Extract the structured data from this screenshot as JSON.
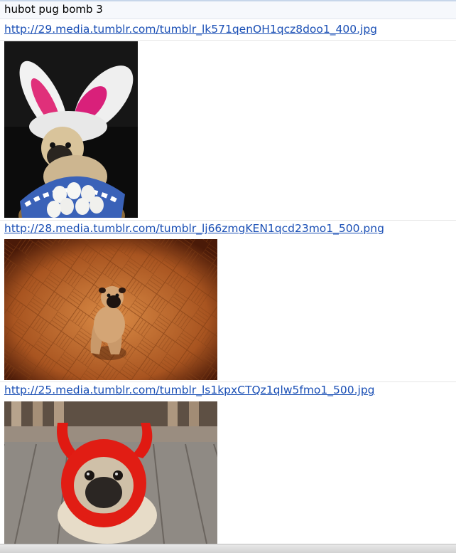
{
  "command": "hubot pug bomb 3",
  "messages": [
    {
      "url": "http://29.media.tumblr.com/tumblr_lk571qenOH1qcz8doo1_400.jpg",
      "image": "pug-bunny-ears-egg-basket"
    },
    {
      "url": "http://28.media.tumblr.com/tumblr_lj66zmgKEN1qcd23mo1_500.png",
      "image": "pug-sitting-on-parquet-floor"
    },
    {
      "url": "http://25.media.tumblr.com/tumblr_ls1kpxCTQz1qlw5fmo1_500.jpg",
      "image": "pug-red-devil-hat-on-deck"
    }
  ]
}
